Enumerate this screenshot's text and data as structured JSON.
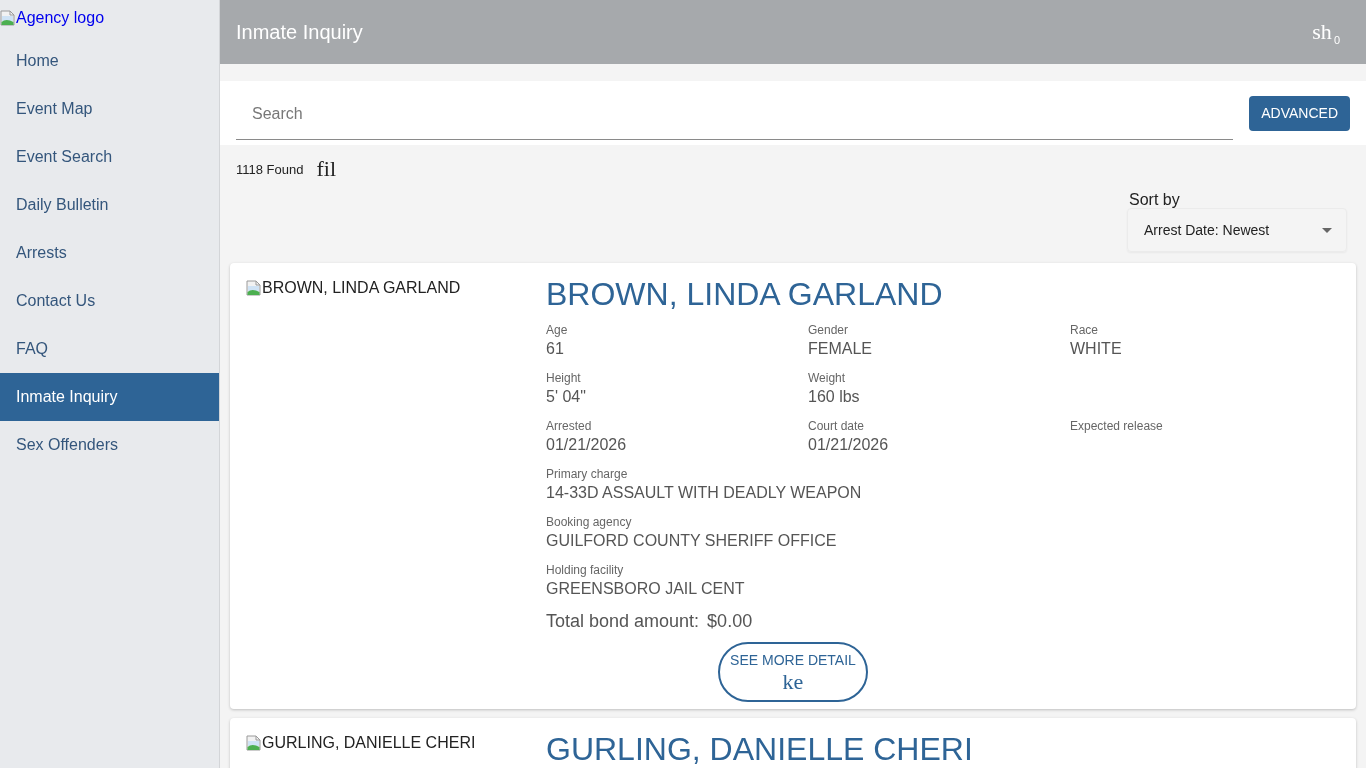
{
  "sidebar": {
    "logo_alt": "Agency logo",
    "items": [
      {
        "label": "Home",
        "selected": false
      },
      {
        "label": "Event Map",
        "selected": false
      },
      {
        "label": "Event Search",
        "selected": false
      },
      {
        "label": "Daily Bulletin",
        "selected": false
      },
      {
        "label": "Arrests",
        "selected": false
      },
      {
        "label": "Contact Us",
        "selected": false
      },
      {
        "label": "FAQ",
        "selected": false
      },
      {
        "label": "Inmate Inquiry",
        "selected": true
      },
      {
        "label": "Sex Offenders",
        "selected": false
      }
    ]
  },
  "header": {
    "title": "Inmate Inquiry",
    "icon_text": "sh",
    "badge": "0"
  },
  "search": {
    "placeholder": "Search",
    "button": "ADVANCED"
  },
  "results": {
    "count": "1118 Found",
    "icon_text": "fil"
  },
  "sort": {
    "label": "Sort by",
    "value": "Arrest Date: Newest"
  },
  "inmates": [
    {
      "photo_alt": "BROWN, LINDA GARLAND",
      "name": "BROWN, LINDA GARLAND",
      "field_rows": [
        [
          {
            "label": "Age",
            "value": "61"
          },
          {
            "label": "Gender",
            "value": "FEMALE"
          },
          {
            "label": "Race",
            "value": "WHITE"
          }
        ],
        [
          {
            "label": "Height",
            "value": "5' 04\""
          },
          {
            "label": "Weight",
            "value": "160 lbs"
          }
        ],
        [
          {
            "label": "Arrested",
            "value": "01/21/2026"
          },
          {
            "label": "Court date",
            "value": "01/21/2026"
          },
          {
            "label": "Expected release"
          }
        ]
      ],
      "details": [
        {
          "label": "Primary charge",
          "value": "14-33D ASSAULT WITH DEADLY WEAPON"
        },
        {
          "label": "Booking agency",
          "value": "GUILFORD COUNTY SHERIFF OFFICE"
        },
        {
          "label": "Holding facility",
          "value": "GREENSBORO JAIL CENT"
        }
      ],
      "bond": {
        "label": "Total bond amount:",
        "value": "$0.00"
      },
      "button": {
        "label": "SEE MORE DETAIL",
        "icon_text": "ke"
      }
    },
    {
      "photo_alt": "GURLING, DANIELLE CHERI",
      "name": "GURLING, DANIELLE CHERI"
    }
  ]
}
